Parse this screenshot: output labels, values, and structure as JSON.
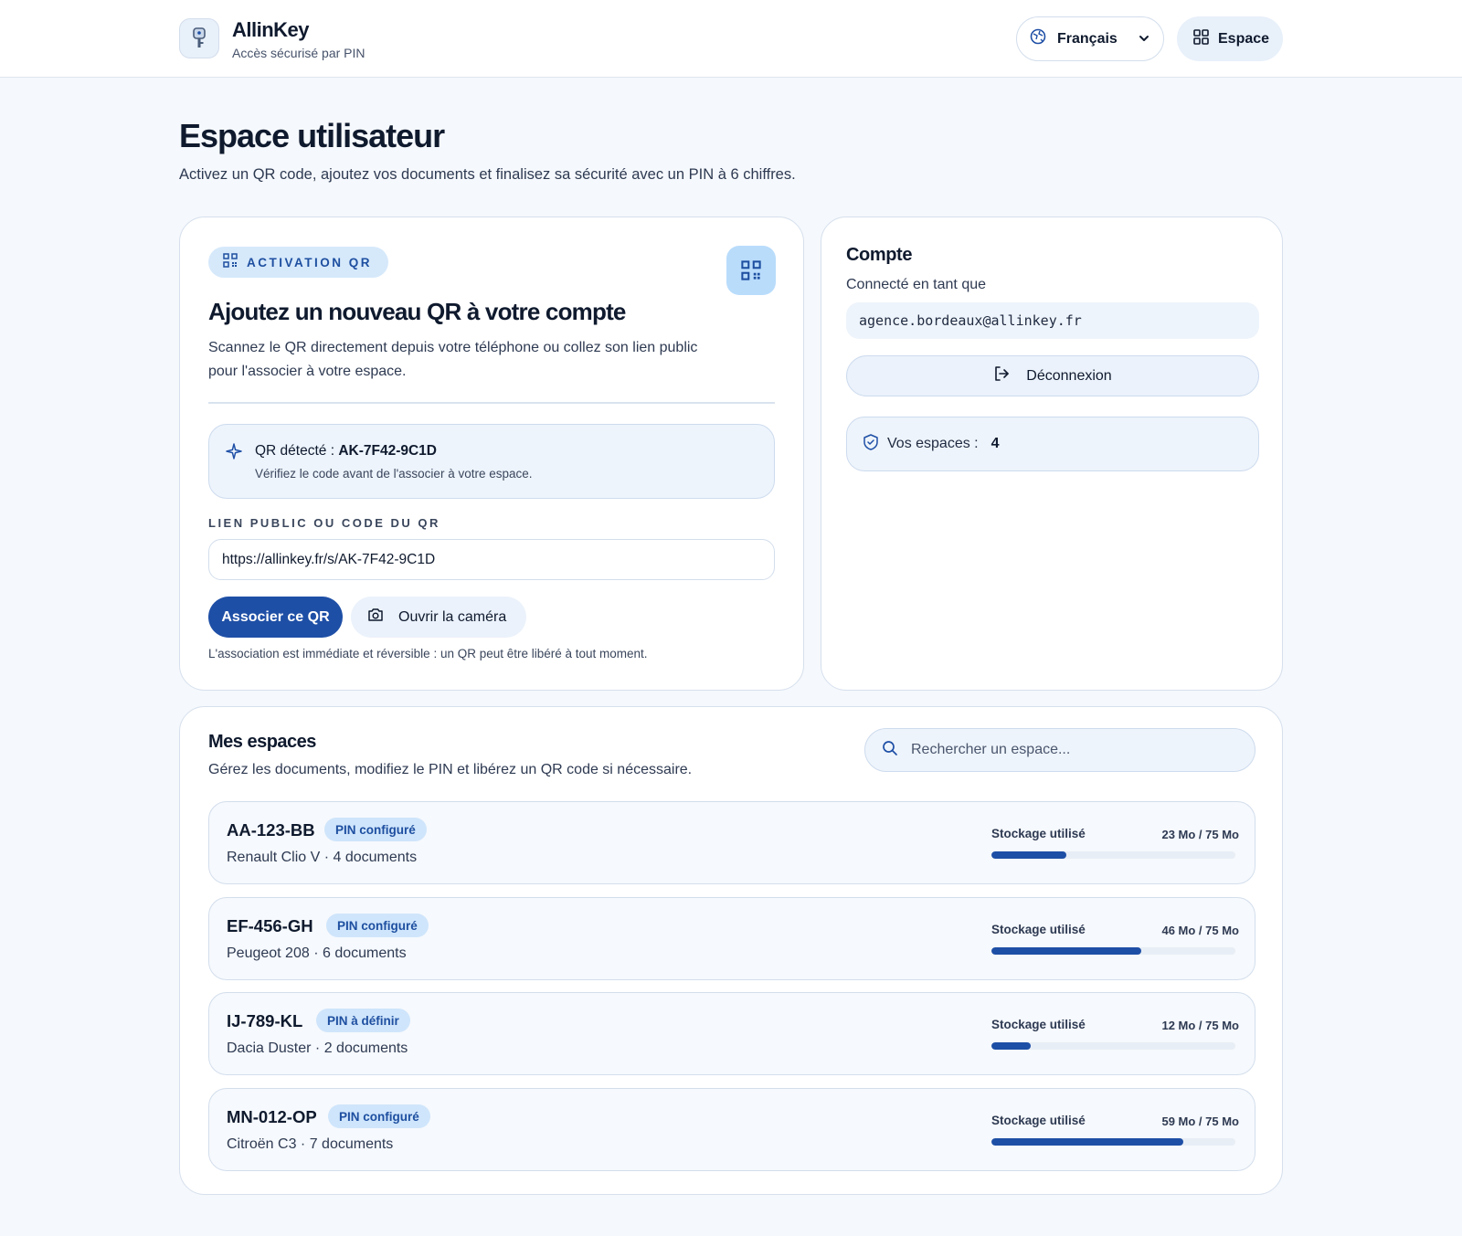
{
  "header": {
    "brand_name": "AllinKey",
    "brand_tagline": "Accès sécurisé par PIN",
    "language_label": "Français",
    "space_button_label": "Espace"
  },
  "page": {
    "title": "Espace utilisateur",
    "subtitle": "Activez un QR code, ajoutez vos documents et finalisez sa sécurité avec un PIN à 6 chiffres."
  },
  "qr_activation": {
    "tag": "ACTIVATION QR",
    "title": "Ajoutez un nouveau QR à votre compte",
    "description": "Scannez le QR directement depuis votre téléphone ou collez son lien public pour l'associer à votre espace.",
    "detected_prefix": "QR détecté :",
    "detected_code": "AK-7F42-9C1D",
    "detected_hint": "Vérifiez le code avant de l'associer à votre espace.",
    "field_label": "LIEN PUBLIC OU CODE DU QR",
    "field_value": "https://allinkey.fr/s/AK-7F42-9C1D",
    "associate_button": "Associer ce QR",
    "camera_button": "Ouvrir la caméra",
    "note": "L'association est immédiate et réversible : un QR peut être libéré à tout moment."
  },
  "account": {
    "title": "Compte",
    "connected_as": "Connecté en tant que",
    "email": "agence.bordeaux@allinkey.fr",
    "logout_button": "Déconnexion",
    "spaces_label": "Vos espaces :",
    "spaces_count": "4"
  },
  "spaces": {
    "title": "Mes espaces",
    "subtitle": "Gérez les documents, modifiez le PIN et libérez un QR code si nécessaire.",
    "search_placeholder": "Rechercher un espace...",
    "storage_label": "Stockage utilisé",
    "items": [
      {
        "plate": "AA-123-BB",
        "badge": "PIN configuré",
        "description": "Renault Clio V · 4 documents",
        "storage_text": "23 Mo / 75 Mo",
        "used_mb": 23,
        "total_mb": 75
      },
      {
        "plate": "EF-456-GH",
        "badge": "PIN configuré",
        "description": "Peugeot 208 · 6 documents",
        "storage_text": "46 Mo / 75 Mo",
        "used_mb": 46,
        "total_mb": 75
      },
      {
        "plate": "IJ-789-KL",
        "badge": "PIN à définir",
        "description": "Dacia Duster · 2 documents",
        "storage_text": "12 Mo / 75 Mo",
        "used_mb": 12,
        "total_mb": 75
      },
      {
        "plate": "MN-012-OP",
        "badge": "PIN configuré",
        "description": "Citroën C3 · 7 documents",
        "storage_text": "59 Mo / 75 Mo",
        "used_mb": 59,
        "total_mb": 75
      }
    ]
  },
  "colors": {
    "accent": "#1e4fa6",
    "badge_bg": "#cfe5fb",
    "page_bg": "#f5f8fc"
  },
  "icons": {
    "logo": "key-icon",
    "language": "globe-icon",
    "space": "grid-icon",
    "qr": "qr-code-icon",
    "detected": "sparkle-icon",
    "camera": "camera-icon",
    "logout": "logout-icon",
    "shield": "shield-check-icon",
    "search": "search-icon"
  }
}
